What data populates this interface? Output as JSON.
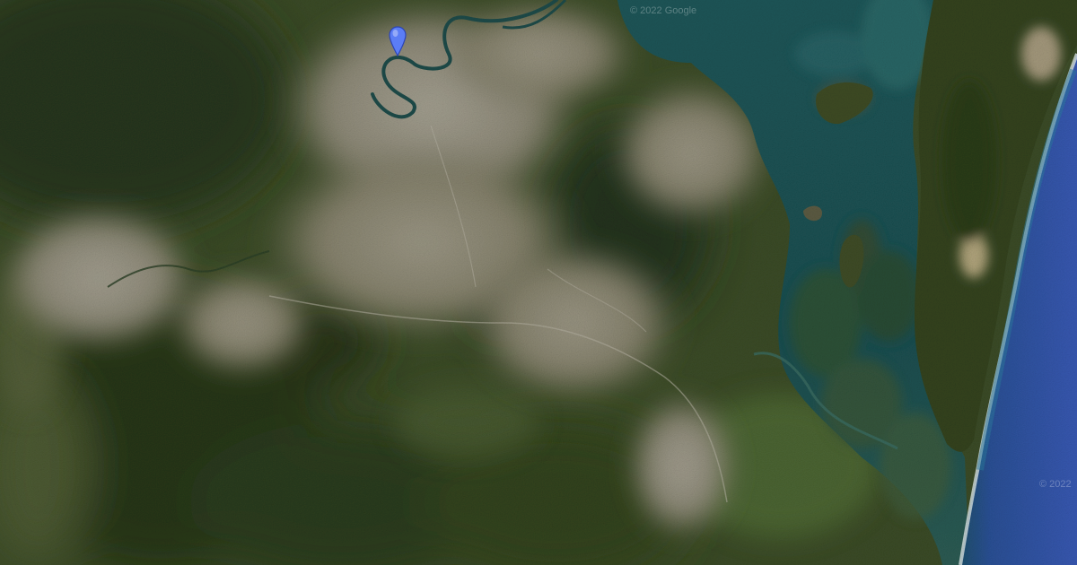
{
  "map": {
    "view_type": "satellite",
    "attribution_top": "© 2022 Google",
    "attribution_right": "© 2022",
    "marker": {
      "icon": "map-pin-icon",
      "color": "#5b7df5"
    }
  },
  "colors": {
    "ocean": "#2d4c9e",
    "bay_water": "#1c4a50",
    "vegetation": "#33451f",
    "urban": "#8c8a7c"
  }
}
